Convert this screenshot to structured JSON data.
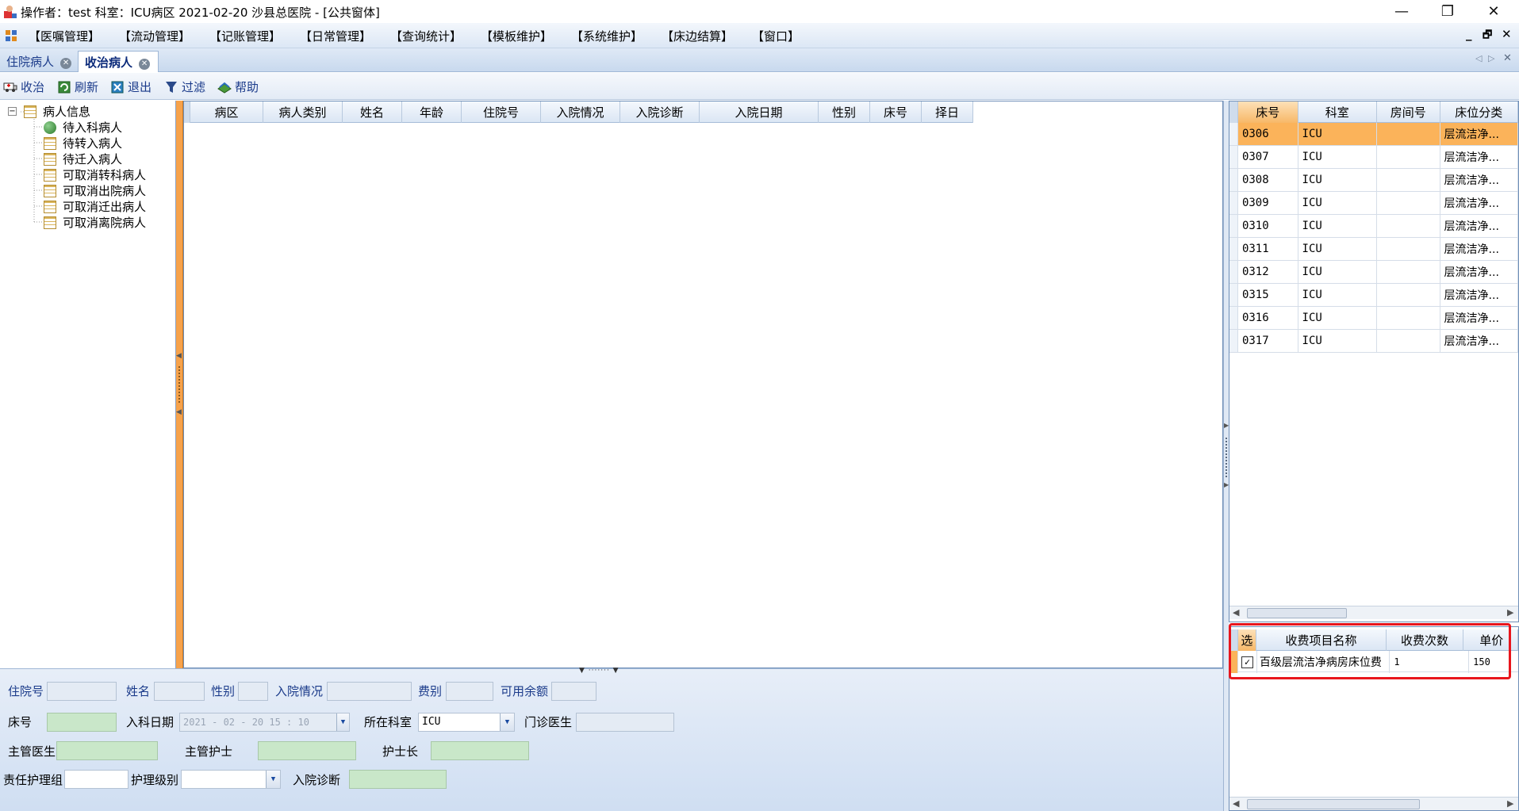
{
  "window": {
    "title": "操作者：test 科室：ICU病区 2021-02-20 沙县总医院 - [公共窗体]",
    "minimize": "—",
    "restore": "❐",
    "close": "✕"
  },
  "menu": {
    "items": [
      "【医嘱管理】",
      "【流动管理】",
      "【记账管理】",
      "【日常管理】",
      "【查询统计】",
      "【模板维护】",
      "【系统维护】",
      "【床边结算】",
      "【窗口】"
    ],
    "mdi": {
      "minimize": "_",
      "restore": "🗗",
      "close": "✕"
    }
  },
  "tabs": [
    {
      "label": "住院病人",
      "active": false
    },
    {
      "label": "收治病人",
      "active": true
    }
  ],
  "toolbar": {
    "admit": "收治",
    "refresh": "刷新",
    "exit": "退出",
    "filter": "过滤",
    "help": "帮助"
  },
  "tree": {
    "root": "病人信息",
    "children": [
      "待入科病人",
      "待转入病人",
      "待迁入病人",
      "可取消转科病人",
      "可取消出院病人",
      "可取消迁出病人",
      "可取消离院病人"
    ]
  },
  "main_grid": {
    "columns": [
      "病区",
      "病人类别",
      "姓名",
      "年龄",
      "住院号",
      "入院情况",
      "入院诊断",
      "入院日期",
      "性别",
      "床号",
      "择日"
    ]
  },
  "bed_grid": {
    "columns": [
      "床号",
      "科室",
      "房间号",
      "床位分类"
    ],
    "rows": [
      {
        "bed": "0306",
        "dept": "ICU",
        "room": "",
        "type": "层流洁净..."
      },
      {
        "bed": "0307",
        "dept": "ICU",
        "room": "",
        "type": "层流洁净..."
      },
      {
        "bed": "0308",
        "dept": "ICU",
        "room": "",
        "type": "层流洁净..."
      },
      {
        "bed": "0309",
        "dept": "ICU",
        "room": "",
        "type": "层流洁净..."
      },
      {
        "bed": "0310",
        "dept": "ICU",
        "room": "",
        "type": "层流洁净..."
      },
      {
        "bed": "0311",
        "dept": "ICU",
        "room": "",
        "type": "层流洁净..."
      },
      {
        "bed": "0312",
        "dept": "ICU",
        "room": "",
        "type": "层流洁净..."
      },
      {
        "bed": "0315",
        "dept": "ICU",
        "room": "",
        "type": "层流洁净..."
      },
      {
        "bed": "0316",
        "dept": "ICU",
        "room": "",
        "type": "层流洁净..."
      },
      {
        "bed": "0317",
        "dept": "ICU",
        "room": "",
        "type": "层流洁净..."
      }
    ],
    "selected_bed": "0306"
  },
  "fee_grid": {
    "columns": [
      "选",
      "收费项目名称",
      "收费次数",
      "单价"
    ],
    "rows": [
      {
        "checked": true,
        "check_mark": "✓",
        "name": "百级层流洁净病房床位费",
        "count": "1",
        "price": "150"
      }
    ]
  },
  "form": {
    "labels": {
      "inpatient_no": "住院号",
      "name": "姓名",
      "gender": "性别",
      "admission_status": "入院情况",
      "fee_type": "费别",
      "balance": "可用余额",
      "bed_no": "床号",
      "admit_date": "入科日期",
      "dept": "所在科室",
      "outpatient_doctor": "门诊医生",
      "attending_doctor": "主管医生",
      "attending_nurse": "主管护士",
      "head_nurse": "护士长",
      "nursing_group": "责任护理组",
      "nursing_level": "护理级别",
      "admission_diagnosis": "入院诊断"
    },
    "values": {
      "admit_date": "2021 - 02 - 20   15 : 10",
      "dept": "ICU",
      "nursing_level": ""
    }
  }
}
